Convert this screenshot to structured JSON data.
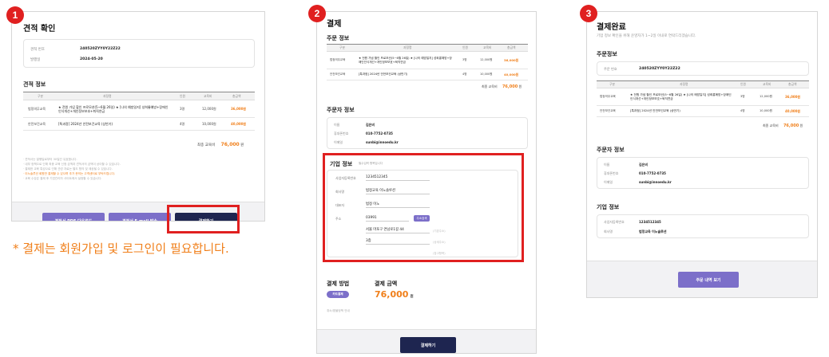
{
  "steps": [
    "1",
    "2",
    "3"
  ],
  "caption": "* 결제는 회원가입 및 로그인이 필요합니다.",
  "quote": {
    "title": "견적 확인",
    "info": [
      {
        "label": "견적 번호",
        "value": "240520ZYY0Y22Z22"
      },
      {
        "label": "발행일",
        "value": "2024-05-20"
      }
    ],
    "section_title": "견적 정보",
    "table_headers": [
      "구분",
      "과정명",
      "인원",
      "교육비",
      "총금액"
    ],
    "rows": [
      {
        "category": "법정의무교육",
        "course": "★ 전원 가념 할인 프로모션(5~6월 26일) ★ [나의 예방일지] 성희롱예방+장애인인식개선+개인정보보호+퇴직연금",
        "people": "3명",
        "fee": "12,000원",
        "total": "36,000원"
      },
      {
        "category": "안전보건교육",
        "course": "[특과정] 2024년 안전보건교육 (상반기)",
        "people": "4명",
        "fee": "10,000원",
        "total": "40,000원"
      }
    ],
    "total_label": "최종 교육비",
    "total_value": "76,000",
    "total_unit": "원",
    "notes": [
      "· 견적서는 발행일로부터 30일간 유효합니다.",
      "· 내부 정책으로 인해 최종 교육 신청 금액과 견적서의 금액이 상이할 수 있습니다.",
      "· 결제한 교육 특성으로 인해 관련 자료는 별도 협의 및 제공될 수 있습니다.",
      "· 이노솔루션 회원만 결제할 수 있으며 추가 문의는 고객센터로 부탁드립니다.",
      "· 교육 수강은 결제 후 기업관리자 사이트에서 설정할 수 있습니다."
    ],
    "btn_pdf": "견적서 PDF 다운로드",
    "btn_email": "견적서 E-mail 발송",
    "btn_pay": "결제하기"
  },
  "payment": {
    "title": "결제",
    "order_title": "주문 정보",
    "table_headers": [
      "구분",
      "과정명",
      "인원",
      "교육비",
      "총금액"
    ],
    "rows": [
      {
        "category": "법정의무교육",
        "course": "★ 전원 가념 할인 프로모션(5~6월 26일) ★ [나의 예방일지] 성희롱예방+장애인인식개선+개인정보보호+퇴직연금",
        "people": "3명",
        "fee": "12,000원",
        "total": "36,000원"
      },
      {
        "category": "안전보건교육",
        "course": "[특과정] 2024년 안전보건교육 (상반기)",
        "people": "4명",
        "fee": "10,000원",
        "total": "40,000원"
      }
    ],
    "total_label": "최종 교육비",
    "total_value": "76,000",
    "total_unit": "원",
    "orderer_title": "주문자 정보",
    "orderer": [
      {
        "label": "이름",
        "value": "김은비"
      },
      {
        "label": "휴대폰번호",
        "value": "010-7752-0735"
      },
      {
        "label": "이메일",
        "value": "sunbi@innoedu.kr"
      }
    ],
    "company_title": "기업 정보",
    "company_note": "필수입력 항목입니다",
    "fields": [
      {
        "label": "사업자등록번호",
        "value": "1234512345"
      },
      {
        "label": "회사명",
        "value": "법정교육 이노솔루션"
      },
      {
        "label": "대표자",
        "value": "법정 이노"
      },
      {
        "label": "주소",
        "value": "03991"
      }
    ],
    "addr_btn": "주소검색",
    "addr1": "서울 마포구 연남로1길 44",
    "addr1_hint": "(기본주소)",
    "addr2": "3층",
    "addr2_hint": "(상세주소)",
    "addr3_hint": "(참고항목)",
    "method_title": "결제 방법",
    "method_option": "카드결제",
    "amount_title": "결제 금액",
    "amount_value": "76,000",
    "amount_unit": "원",
    "terms": "취소/환불정책 안내",
    "pay_btn": "결제하기"
  },
  "complete": {
    "title": "결제완료",
    "subtitle": "기업 정보 확인을 위해 운영자가 1~2일 이내로 연락드리겠습니다.",
    "order_title": "주문정보",
    "order_no_label": "주문 번호",
    "order_no": "240520ZYY0Y22Z22",
    "table_headers": [
      "구분",
      "과정명",
      "인원",
      "교육비",
      "총금액"
    ],
    "rows": [
      {
        "category": "법정의무교육",
        "course": "★ 전원 가념 할인 프로모션(5~6월 26일) ★ [나의 예방일지] 성희롱예방+장애인인식개선+개인정보보호+퇴직연금",
        "people": "3명",
        "fee": "12,000원",
        "total": "36,000원"
      },
      {
        "category": "안전보건교육",
        "course": "[특과정] 2024년 안전보건교육 (상반기)",
        "people": "4명",
        "fee": "10,000원",
        "total": "40,000원"
      }
    ],
    "total_label": "최종 교육비",
    "total_value": "76,000",
    "total_unit": "원",
    "orderer_title": "주문자 정보",
    "orderer": [
      {
        "label": "이름",
        "value": "김은비"
      },
      {
        "label": "휴대폰번호",
        "value": "010-7752-0735"
      },
      {
        "label": "이메일",
        "value": "sunbi@innoedu.kr"
      }
    ],
    "company_title": "기업 정보",
    "company": [
      {
        "label": "사업자등록번호",
        "value": "1234512345"
      },
      {
        "label": "회사명",
        "value": "법정교육 이노솔루션"
      }
    ],
    "history_btn": "주문 내역 보기"
  },
  "colors": {
    "accent": "#f07f1a",
    "purple": "#7c6fc9",
    "navy": "#1e2550",
    "red": "#e02020"
  }
}
